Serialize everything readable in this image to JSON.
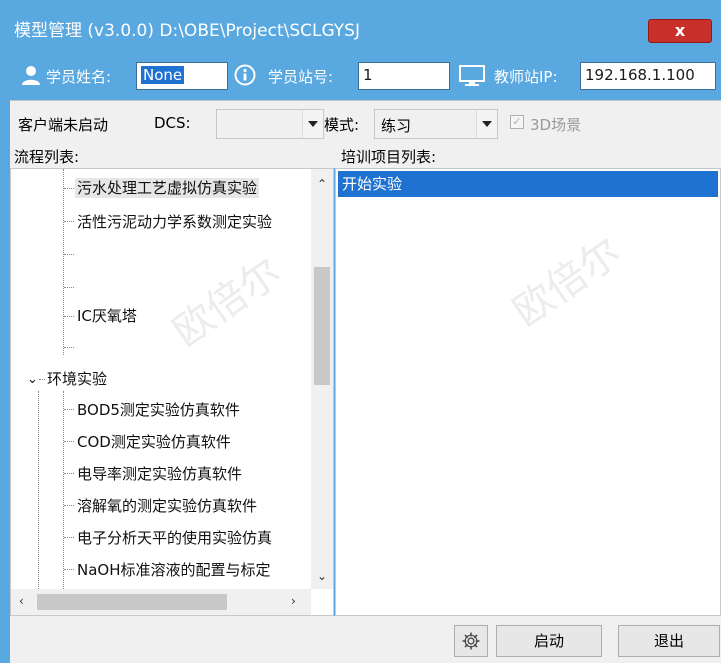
{
  "titlebar": {
    "title": "模型管理 (v3.0.0) D:\\OBE\\Project\\SCLGYSJ",
    "close_label": "x"
  },
  "userbar": {
    "student_name_label": "学员姓名:",
    "student_name_value": "None",
    "station_label": "学员站号:",
    "station_value": "1",
    "teacher_ip_label": "教师站IP:",
    "teacher_ip_value": "192.168.1.100"
  },
  "toolbar": {
    "client_status": "客户端未启动",
    "dcs_label": "DCS:",
    "dcs_value": "",
    "mode_label": "模式:",
    "mode_value": "练习",
    "scene3d_label": "3D场景",
    "scene3d_checked": true
  },
  "left_panel": {
    "header": "流程列表:",
    "items": [
      "污水处理工艺虚拟仿真实验",
      "活性污泥动力学系数测定实验",
      "IC厌氧塔"
    ],
    "group": "环境实验",
    "group_items": [
      "BOD5测定实验仿真软件",
      "COD测定实验仿真软件",
      "电导率测定实验仿真软件",
      "溶解氧的测定实验仿真软件",
      "电子分析天平的使用实验仿真",
      "NaOH标准溶液的配置与标定"
    ]
  },
  "right_panel": {
    "header": "培训项目列表:",
    "items": [
      "开始实验"
    ]
  },
  "watermark": "欧倍尔",
  "bottombar": {
    "start_label": "启动",
    "exit_label": "退出"
  },
  "colors": {
    "titlebar": "#5aa8e0",
    "selection": "#1f72d0",
    "close": "#c9302c"
  }
}
